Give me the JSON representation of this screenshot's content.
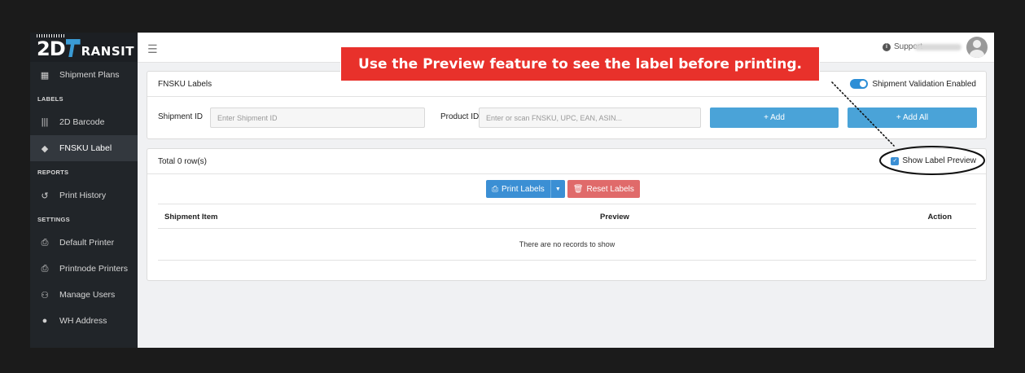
{
  "brand": {
    "logo_mark": "2D",
    "logo_rest": "RANSIT"
  },
  "sidebar": {
    "items": [
      {
        "icon": "boxes-icon",
        "glyph": "▦",
        "label": "Shipment Plans",
        "active": false
      },
      {
        "section": "LABELS"
      },
      {
        "icon": "barcode-icon",
        "glyph": "|||",
        "label": "2D Barcode",
        "active": false
      },
      {
        "icon": "tags-icon",
        "glyph": "◆",
        "label": "FNSKU Label",
        "active": true
      },
      {
        "section": "REPORTS"
      },
      {
        "icon": "history-icon",
        "glyph": "↺",
        "label": "Print History",
        "active": false
      },
      {
        "section": "SETTINGS"
      },
      {
        "icon": "printer-icon",
        "glyph": "⎙",
        "label": "Default Printer",
        "active": false
      },
      {
        "icon": "printer-icon",
        "glyph": "⎙",
        "label": "Printnode Printers",
        "active": false
      },
      {
        "icon": "users-icon",
        "glyph": "⚇",
        "label": "Manage Users",
        "active": false
      },
      {
        "icon": "map-marker-icon",
        "glyph": "●",
        "label": "WH Address",
        "active": false
      }
    ]
  },
  "topbar": {
    "support_label": "Support"
  },
  "fnsku_card": {
    "title": "FNSKU Labels",
    "validation_toggle_label": "Shipment Validation Enabled",
    "shipment_id_label": "Shipment ID",
    "shipment_id_placeholder": "Enter Shipment ID",
    "product_id_label": "Product ID",
    "product_id_placeholder": "Enter or scan FNSKU, UPC, EAN, ASIN...",
    "add_button": "+ Add",
    "add_all_button": "+ Add All"
  },
  "table_card": {
    "total_rows": "Total 0 row(s)",
    "show_preview_label": "Show Label Preview",
    "print_button": "Print Labels",
    "reset_button": "Reset Labels",
    "columns": [
      "Shipment Item",
      "Preview",
      "Action"
    ],
    "empty_message": "There are no records to show"
  },
  "callout": {
    "text": "Use the Preview feature to see the label before printing."
  },
  "colors": {
    "accent": "#3b8fd4",
    "callout": "#e8312b",
    "sidebar": "#212529",
    "danger": "#e06a6a"
  }
}
